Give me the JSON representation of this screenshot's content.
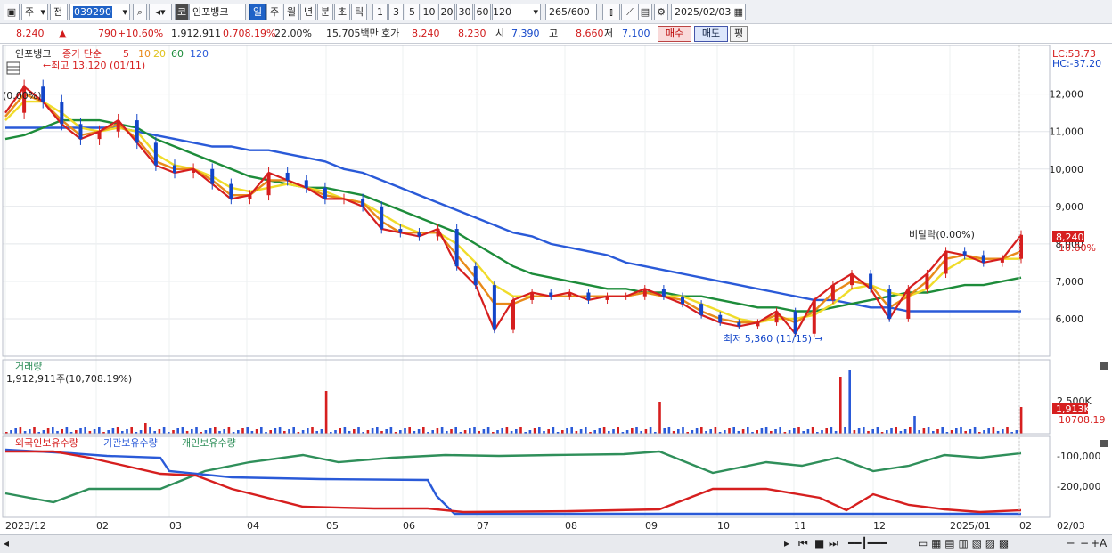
{
  "toolbar": {
    "period_unit": "주",
    "prev_label": "전",
    "code": "039290",
    "market_badge": "코",
    "stock_name": "인포뱅크",
    "periods": [
      "일",
      "주",
      "월",
      "년",
      "분",
      "초",
      "틱"
    ],
    "selected_period": "일",
    "intervals": [
      "1",
      "3",
      "5",
      "10",
      "20",
      "30",
      "60",
      "120"
    ],
    "count": "265",
    "total": "/600",
    "date": "2025/02/03"
  },
  "quote": {
    "price": "8,240",
    "change": "790",
    "change_pct": "+10.60%",
    "volume": "1,912,911",
    "volume_ratio": "0.708.19%",
    "turnover": "22.00%",
    "amount": "15,705백만",
    "bid_label": "호가",
    "ask": "8,240",
    "bid": "8,230",
    "open_label": "시",
    "open": "7,390",
    "high_label": "고",
    "high": "8,660",
    "low_label": "저",
    "low": "7,100",
    "buy_btn": "매수",
    "sell_btn": "매도",
    "avg_btn": "평"
  },
  "price_panel": {
    "legend_name": "인포뱅크",
    "legend_main": "종가 단순",
    "ma_labels": [
      "5",
      "10",
      "20",
      "60",
      "120"
    ],
    "ma_colors": [
      "#d61f1f",
      "#e88a1a",
      "#f0dc2a",
      "#1d8c3a",
      "#2a5ad8"
    ],
    "ref_label": "(0.00%)",
    "high_annotation": "최고 13,120 (01/11)",
    "low_annotation": "최저 5,360 (11/15)",
    "event_annotation": "비탈락(0.00%)",
    "lc": "LC:53.73",
    "hc": "HC:-37.20",
    "price_tag": "8,240",
    "pct_tag": "10.60%"
  },
  "volume_panel": {
    "title": "거래량",
    "value": "1,912,911주(10,708.19%)",
    "tag": "1,913K",
    "tag2": "10708.19",
    "axis": "2,500K"
  },
  "holdings_panel": {
    "legend": [
      "외국인보유수량",
      "기관보유수량",
      "개인보유수량"
    ],
    "colors": [
      "#d61f1f",
      "#2a5ad8",
      "#2f8f5a"
    ],
    "axis": [
      "-100,000",
      "-200,000"
    ]
  },
  "x_axis": [
    "2023/12",
    "02",
    "03",
    "04",
    "05",
    "06",
    "07",
    "08",
    "09",
    "10",
    "11",
    "12",
    "2025/01",
    "02",
    "02/03"
  ],
  "chart_data": {
    "type": "line",
    "title": "",
    "ylabel": "",
    "yticks": [
      6000,
      7000,
      8000,
      9000,
      10000,
      11000,
      12000
    ],
    "ylim": [
      5000,
      13300
    ],
    "series": [
      {
        "name": "종가",
        "values": [
          11500,
          12200,
          11800,
          11200,
          10800,
          11000,
          11300,
          10700,
          10100,
          9900,
          10000,
          9600,
          9200,
          9300,
          9900,
          9700,
          9500,
          9200,
          9200,
          9000,
          8400,
          8300,
          8200,
          8400,
          7400,
          6900,
          5700,
          6500,
          6700,
          6600,
          6700,
          6500,
          6600,
          6600,
          6800,
          6600,
          6400,
          6100,
          5900,
          5800,
          5900,
          6200,
          5600,
          6500,
          6900,
          7200,
          6800,
          6000,
          6800,
          7200,
          7800,
          7700,
          7500,
          7600,
          8240
        ]
      },
      {
        "name": "5",
        "values": [
          11400,
          12000,
          11800,
          11300,
          10900,
          11000,
          11200,
          10800,
          10200,
          10000,
          10000,
          9700,
          9300,
          9300,
          9700,
          9700,
          9500,
          9300,
          9200,
          9100,
          8600,
          8300,
          8300,
          8300,
          7700,
          7100,
          6400,
          6400,
          6600,
          6600,
          6600,
          6600,
          6600,
          6600,
          6700,
          6600,
          6500,
          6200,
          6000,
          5900,
          5900,
          6100,
          5900,
          6200,
          6700,
          7000,
          6900,
          6300,
          6600,
          7000,
          7600,
          7700,
          7600,
          7600,
          7800
        ]
      },
      {
        "name": "20",
        "values": [
          11300,
          11800,
          11800,
          11500,
          11100,
          11000,
          11100,
          11000,
          10400,
          10100,
          10000,
          9800,
          9500,
          9400,
          9500,
          9600,
          9500,
          9400,
          9200,
          9100,
          8800,
          8500,
          8300,
          8300,
          8000,
          7500,
          6900,
          6600,
          6600,
          6600,
          6600,
          6600,
          6600,
          6600,
          6700,
          6600,
          6600,
          6400,
          6200,
          6000,
          5900,
          6000,
          6000,
          6100,
          6400,
          6800,
          6900,
          6700,
          6600,
          6800,
          7300,
          7600,
          7600,
          7600,
          7600
        ]
      },
      {
        "name": "60",
        "values": [
          10800,
          10900,
          11100,
          11300,
          11300,
          11300,
          11200,
          11100,
          10800,
          10600,
          10400,
          10200,
          10000,
          9800,
          9700,
          9600,
          9500,
          9500,
          9400,
          9300,
          9100,
          8900,
          8700,
          8500,
          8300,
          8000,
          7700,
          7400,
          7200,
          7100,
          7000,
          6900,
          6800,
          6800,
          6700,
          6700,
          6600,
          6600,
          6500,
          6400,
          6300,
          6300,
          6200,
          6200,
          6300,
          6400,
          6500,
          6600,
          6700,
          6700,
          6800,
          6900,
          6900,
          7000,
          7100
        ]
      },
      {
        "name": "120",
        "values": [
          11100,
          11100,
          11100,
          11100,
          11100,
          11100,
          11100,
          11000,
          10900,
          10800,
          10700,
          10600,
          10600,
          10500,
          10500,
          10400,
          10300,
          10200,
          10000,
          9900,
          9700,
          9500,
          9300,
          9100,
          8900,
          8700,
          8500,
          8300,
          8200,
          8000,
          7900,
          7800,
          7700,
          7500,
          7400,
          7300,
          7200,
          7100,
          7000,
          6900,
          6800,
          6700,
          6600,
          6500,
          6500,
          6400,
          6300,
          6300,
          6200,
          6200,
          6200,
          6200,
          6200,
          6200,
          6200
        ]
      }
    ]
  }
}
